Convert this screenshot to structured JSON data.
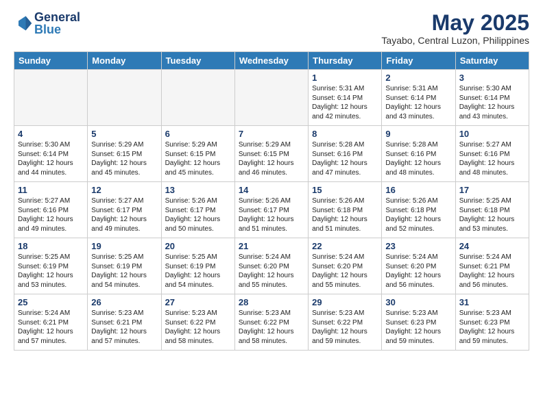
{
  "header": {
    "logo_line1": "General",
    "logo_line2": "Blue",
    "month_title": "May 2025",
    "location": "Tayabo, Central Luzon, Philippines"
  },
  "days_of_week": [
    "Sunday",
    "Monday",
    "Tuesday",
    "Wednesday",
    "Thursday",
    "Friday",
    "Saturday"
  ],
  "weeks": [
    [
      {
        "day": "",
        "info": ""
      },
      {
        "day": "",
        "info": ""
      },
      {
        "day": "",
        "info": ""
      },
      {
        "day": "",
        "info": ""
      },
      {
        "day": "1",
        "info": "Sunrise: 5:31 AM\nSunset: 6:14 PM\nDaylight: 12 hours\nand 42 minutes."
      },
      {
        "day": "2",
        "info": "Sunrise: 5:31 AM\nSunset: 6:14 PM\nDaylight: 12 hours\nand 43 minutes."
      },
      {
        "day": "3",
        "info": "Sunrise: 5:30 AM\nSunset: 6:14 PM\nDaylight: 12 hours\nand 43 minutes."
      }
    ],
    [
      {
        "day": "4",
        "info": "Sunrise: 5:30 AM\nSunset: 6:14 PM\nDaylight: 12 hours\nand 44 minutes."
      },
      {
        "day": "5",
        "info": "Sunrise: 5:29 AM\nSunset: 6:15 PM\nDaylight: 12 hours\nand 45 minutes."
      },
      {
        "day": "6",
        "info": "Sunrise: 5:29 AM\nSunset: 6:15 PM\nDaylight: 12 hours\nand 45 minutes."
      },
      {
        "day": "7",
        "info": "Sunrise: 5:29 AM\nSunset: 6:15 PM\nDaylight: 12 hours\nand 46 minutes."
      },
      {
        "day": "8",
        "info": "Sunrise: 5:28 AM\nSunset: 6:16 PM\nDaylight: 12 hours\nand 47 minutes."
      },
      {
        "day": "9",
        "info": "Sunrise: 5:28 AM\nSunset: 6:16 PM\nDaylight: 12 hours\nand 48 minutes."
      },
      {
        "day": "10",
        "info": "Sunrise: 5:27 AM\nSunset: 6:16 PM\nDaylight: 12 hours\nand 48 minutes."
      }
    ],
    [
      {
        "day": "11",
        "info": "Sunrise: 5:27 AM\nSunset: 6:16 PM\nDaylight: 12 hours\nand 49 minutes."
      },
      {
        "day": "12",
        "info": "Sunrise: 5:27 AM\nSunset: 6:17 PM\nDaylight: 12 hours\nand 49 minutes."
      },
      {
        "day": "13",
        "info": "Sunrise: 5:26 AM\nSunset: 6:17 PM\nDaylight: 12 hours\nand 50 minutes."
      },
      {
        "day": "14",
        "info": "Sunrise: 5:26 AM\nSunset: 6:17 PM\nDaylight: 12 hours\nand 51 minutes."
      },
      {
        "day": "15",
        "info": "Sunrise: 5:26 AM\nSunset: 6:18 PM\nDaylight: 12 hours\nand 51 minutes."
      },
      {
        "day": "16",
        "info": "Sunrise: 5:26 AM\nSunset: 6:18 PM\nDaylight: 12 hours\nand 52 minutes."
      },
      {
        "day": "17",
        "info": "Sunrise: 5:25 AM\nSunset: 6:18 PM\nDaylight: 12 hours\nand 53 minutes."
      }
    ],
    [
      {
        "day": "18",
        "info": "Sunrise: 5:25 AM\nSunset: 6:19 PM\nDaylight: 12 hours\nand 53 minutes."
      },
      {
        "day": "19",
        "info": "Sunrise: 5:25 AM\nSunset: 6:19 PM\nDaylight: 12 hours\nand 54 minutes."
      },
      {
        "day": "20",
        "info": "Sunrise: 5:25 AM\nSunset: 6:19 PM\nDaylight: 12 hours\nand 54 minutes."
      },
      {
        "day": "21",
        "info": "Sunrise: 5:24 AM\nSunset: 6:20 PM\nDaylight: 12 hours\nand 55 minutes."
      },
      {
        "day": "22",
        "info": "Sunrise: 5:24 AM\nSunset: 6:20 PM\nDaylight: 12 hours\nand 55 minutes."
      },
      {
        "day": "23",
        "info": "Sunrise: 5:24 AM\nSunset: 6:20 PM\nDaylight: 12 hours\nand 56 minutes."
      },
      {
        "day": "24",
        "info": "Sunrise: 5:24 AM\nSunset: 6:21 PM\nDaylight: 12 hours\nand 56 minutes."
      }
    ],
    [
      {
        "day": "25",
        "info": "Sunrise: 5:24 AM\nSunset: 6:21 PM\nDaylight: 12 hours\nand 57 minutes."
      },
      {
        "day": "26",
        "info": "Sunrise: 5:23 AM\nSunset: 6:21 PM\nDaylight: 12 hours\nand 57 minutes."
      },
      {
        "day": "27",
        "info": "Sunrise: 5:23 AM\nSunset: 6:22 PM\nDaylight: 12 hours\nand 58 minutes."
      },
      {
        "day": "28",
        "info": "Sunrise: 5:23 AM\nSunset: 6:22 PM\nDaylight: 12 hours\nand 58 minutes."
      },
      {
        "day": "29",
        "info": "Sunrise: 5:23 AM\nSunset: 6:22 PM\nDaylight: 12 hours\nand 59 minutes."
      },
      {
        "day": "30",
        "info": "Sunrise: 5:23 AM\nSunset: 6:23 PM\nDaylight: 12 hours\nand 59 minutes."
      },
      {
        "day": "31",
        "info": "Sunrise: 5:23 AM\nSunset: 6:23 PM\nDaylight: 12 hours\nand 59 minutes."
      }
    ]
  ]
}
